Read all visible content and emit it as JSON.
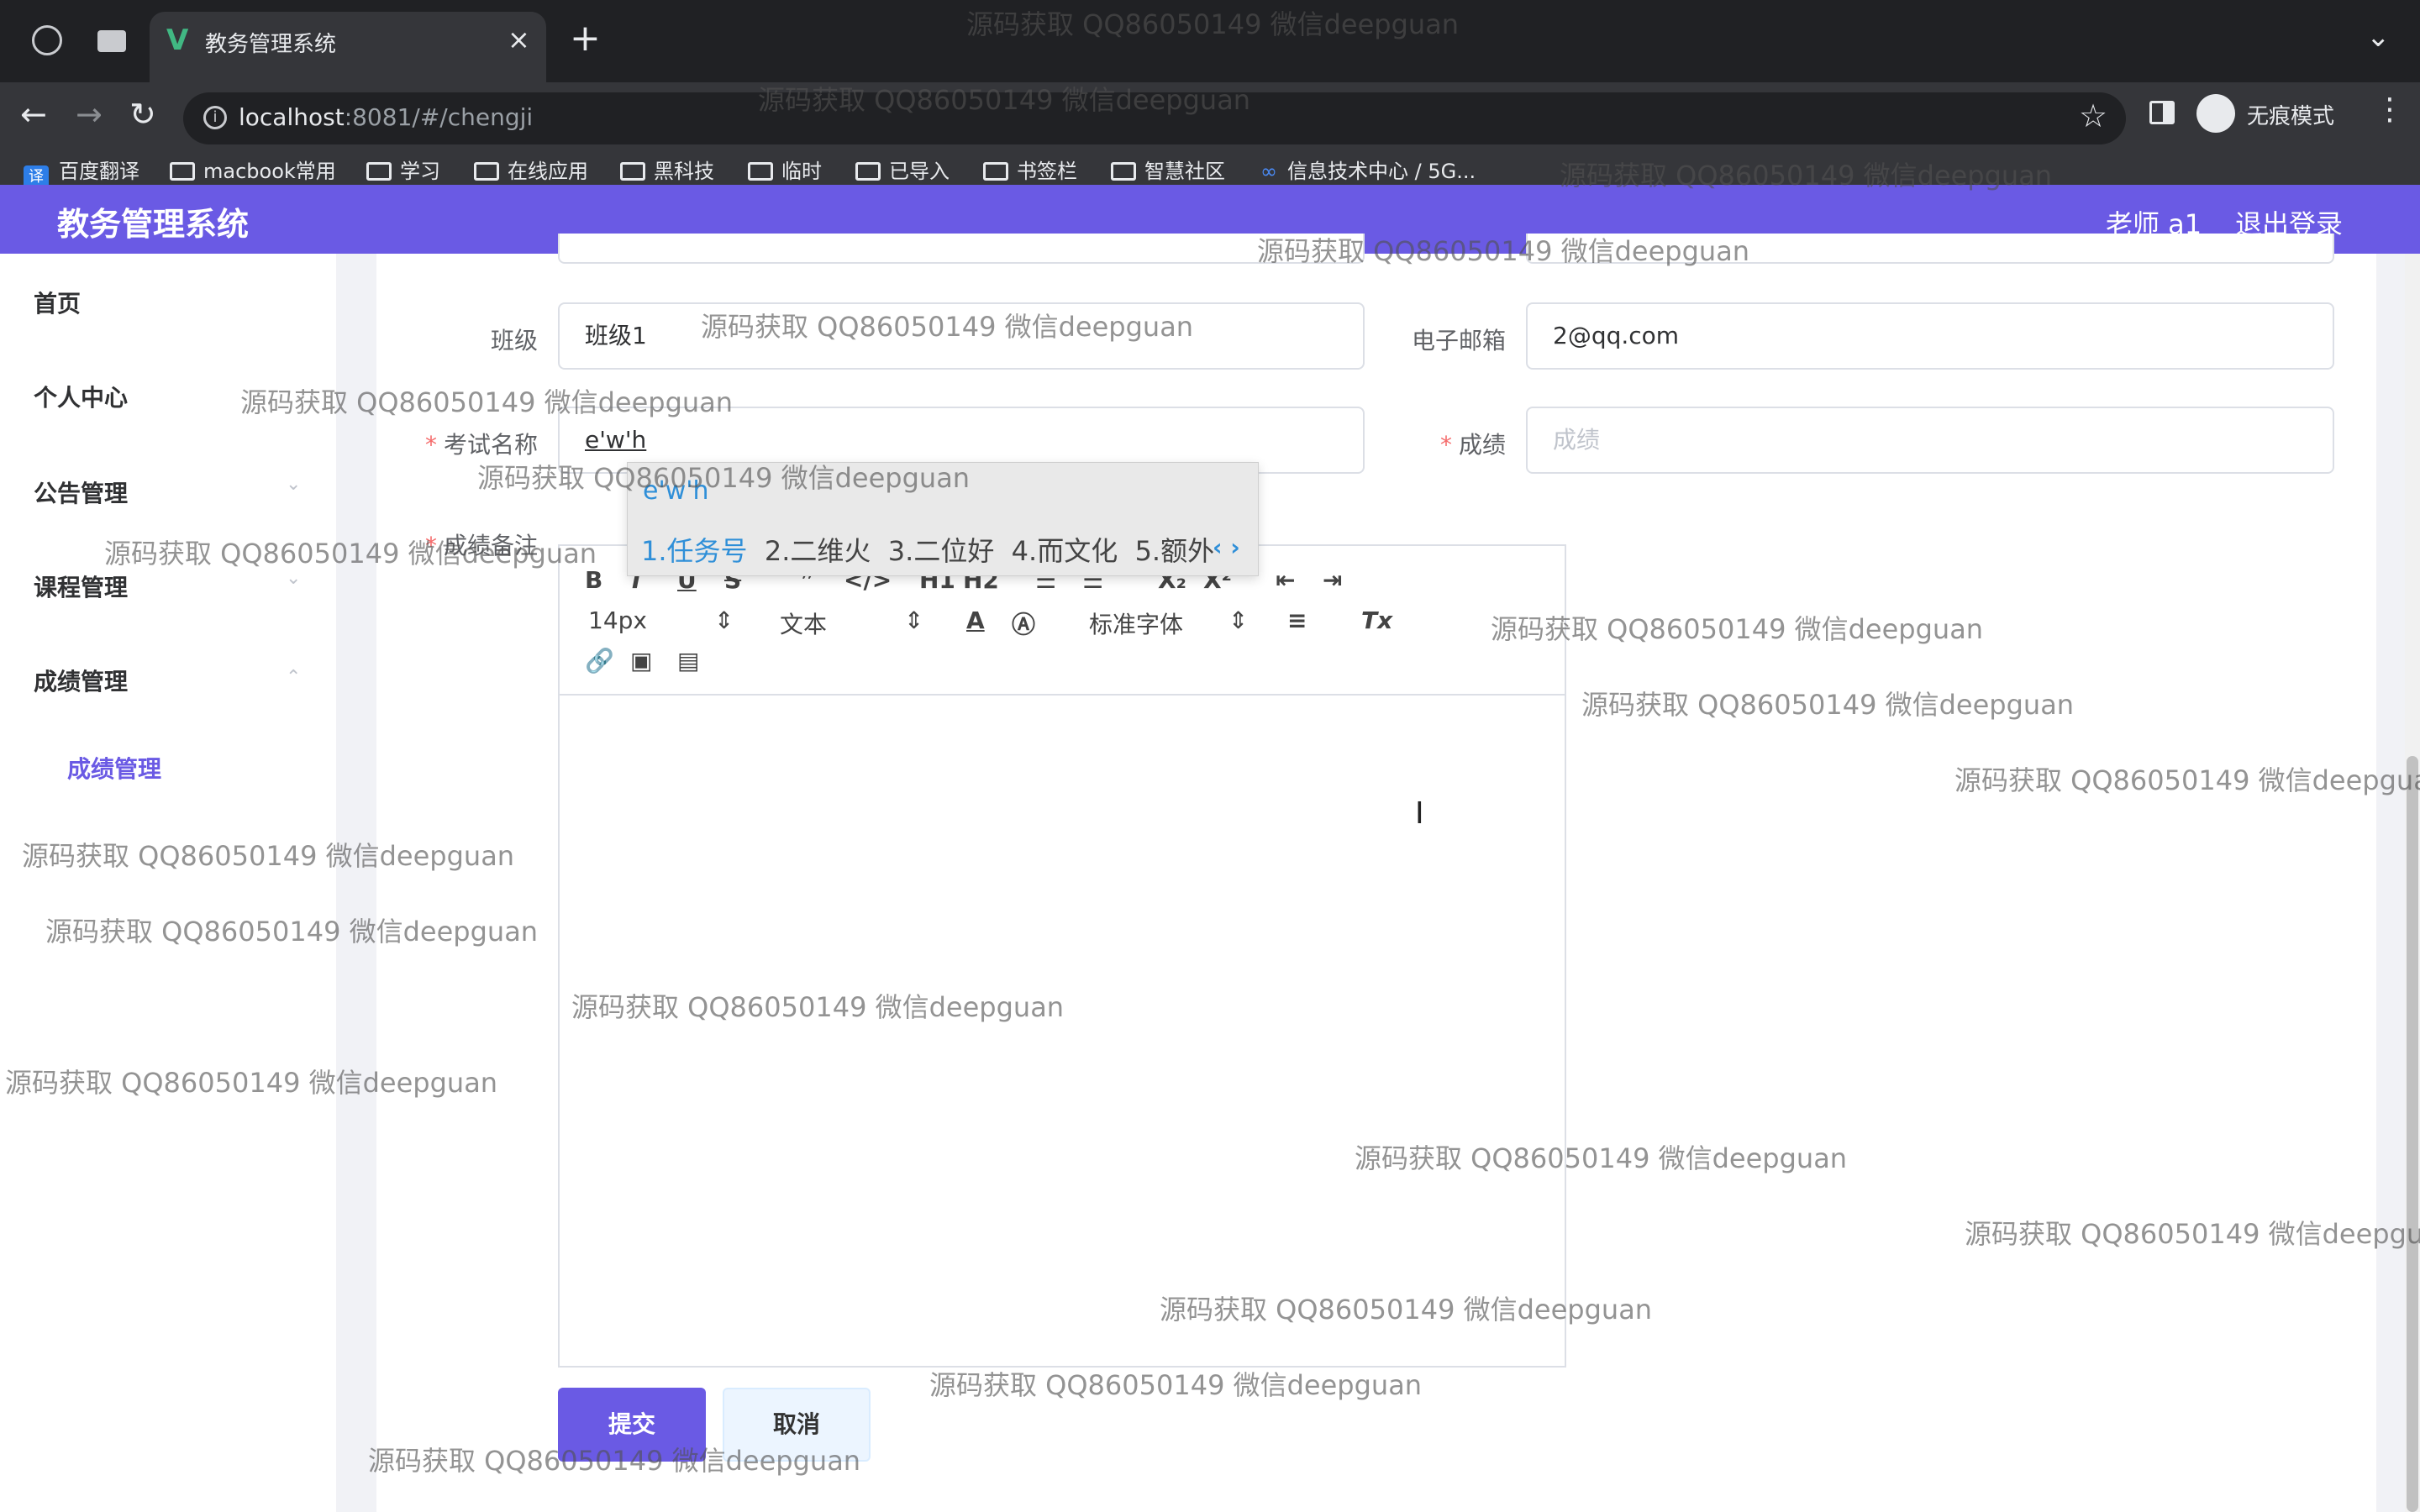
{
  "browser": {
    "tab_title": "教务管理系统",
    "tab_close": "×",
    "new_tab": "+",
    "url_host": "localhost",
    "url_rest": ":8081/#/chengji",
    "incognito_label": "无痕模式",
    "bookmarks": [
      "百度翻译",
      "macbook常用",
      "学习",
      "在线应用",
      "黑科技",
      "临时",
      "已导入",
      "书签栏",
      "智慧社区",
      "信息技术中心 / 5G..."
    ],
    "fanyi_glyph": "译"
  },
  "header": {
    "title": "教务管理系统",
    "user": "老师 a1",
    "logout": "退出登录"
  },
  "sidebar": {
    "items": [
      "首页",
      "个人中心",
      "公告管理",
      "课程管理",
      "成绩管理"
    ],
    "sub_item": "成绩管理"
  },
  "form": {
    "class_label": "班级",
    "class_value": "班级1",
    "email_label": "电子邮箱",
    "email_value": "2@qq.com",
    "exam_label": "考试名称",
    "exam_value": "e'w'h",
    "score_label": "成绩",
    "score_placeholder": "成绩",
    "remark_label": "成绩备注",
    "required_mark": "*"
  },
  "editor": {
    "font_size": "14px",
    "text_type": "文本",
    "font_family": "标准字体",
    "icons": [
      "bold-icon",
      "italic-icon",
      "underline-icon",
      "strike-icon",
      "blockquote-icon",
      "code-block-icon",
      "header-1-icon",
      "header-2-icon",
      "ordered-list-icon",
      "bullet-list-icon",
      "subscript-icon",
      "superscript-icon",
      "outdent-icon",
      "indent-icon",
      "font-color-icon",
      "background-color-icon",
      "align-icon",
      "clean-icon",
      "link-icon",
      "image-icon",
      "video-icon"
    ]
  },
  "ime": {
    "composition": "e'w'h",
    "candidates": [
      "1.任务号",
      "2.二维火",
      "3.二位好",
      "4.而文化",
      "5.额外"
    ]
  },
  "buttons": {
    "submit": "提交",
    "cancel": "取消"
  },
  "watermark": "源码获取 QQ86050149 微信deepguan",
  "colors": {
    "accent": "#6a5ae4",
    "chrome_dark": "#202124",
    "chrome_mid": "#35363a",
    "required": "#f56c6c",
    "ime_blue": "#2f8fd8"
  }
}
